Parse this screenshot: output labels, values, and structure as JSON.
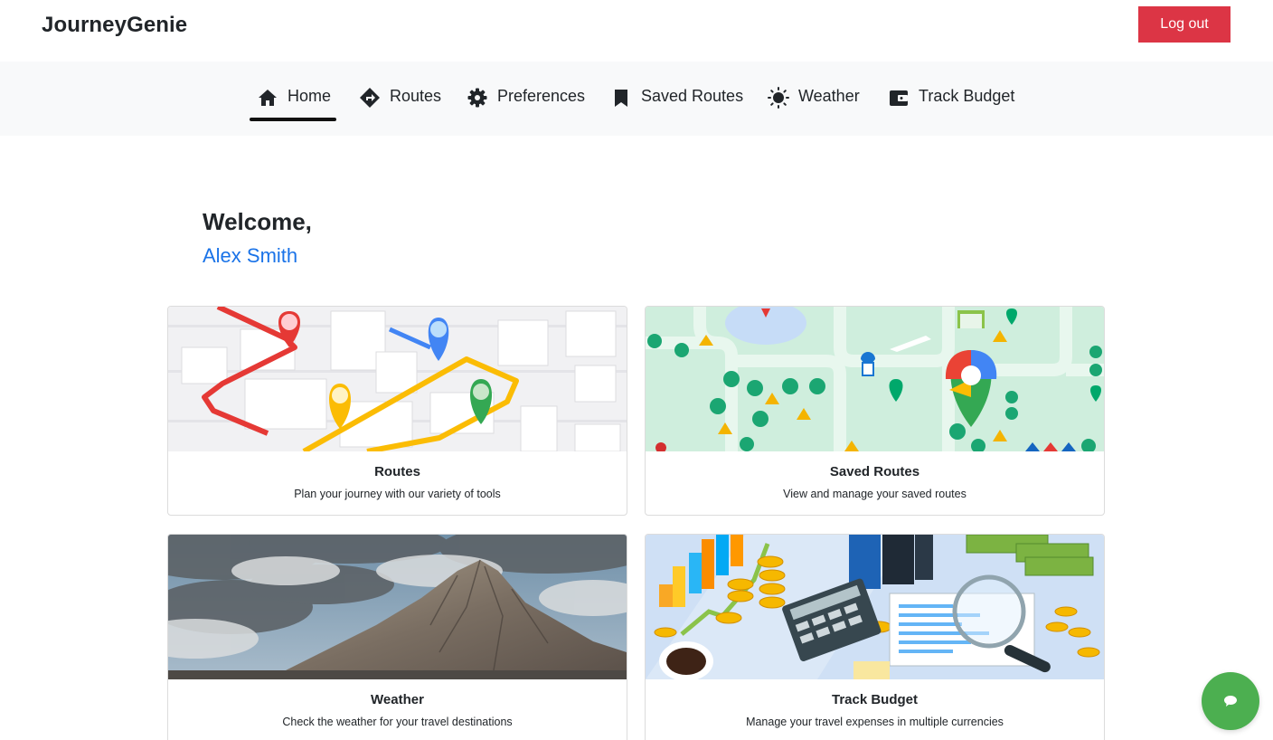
{
  "app": {
    "brand": "JourneyGenie",
    "logout_label": "Log out"
  },
  "nav": {
    "items": [
      {
        "label": "Home",
        "icon": "home-icon",
        "active": true
      },
      {
        "label": "Routes",
        "icon": "directions-icon"
      },
      {
        "label": "Preferences",
        "icon": "gear-icon"
      },
      {
        "label": "Saved Routes",
        "icon": "bookmark-icon"
      },
      {
        "label": "Weather",
        "icon": "sun-icon"
      },
      {
        "label": "Track Budget",
        "icon": "wallet-icon"
      }
    ]
  },
  "welcome": {
    "greeting": "Welcome,",
    "user_name": "Alex Smith"
  },
  "cards": [
    {
      "title": "Routes",
      "description": "Plan your journey with our variety of tools",
      "image": "map-route-illustration"
    },
    {
      "title": "Saved Routes",
      "description": "View and manage your saved routes",
      "image": "map-pins-illustration"
    },
    {
      "title": "Weather",
      "description": "Check the weather for your travel destinations",
      "image": "mountain-photo"
    },
    {
      "title": "Track Budget",
      "description": "Manage your travel expenses in multiple currencies",
      "image": "budget-illustration"
    }
  ],
  "chat": {
    "icon": "chat-icon"
  },
  "colors": {
    "logout": "#dc3545",
    "accent": "#1a73e8",
    "chat": "#4caf50",
    "navbar_bg": "#f8f9fa"
  }
}
